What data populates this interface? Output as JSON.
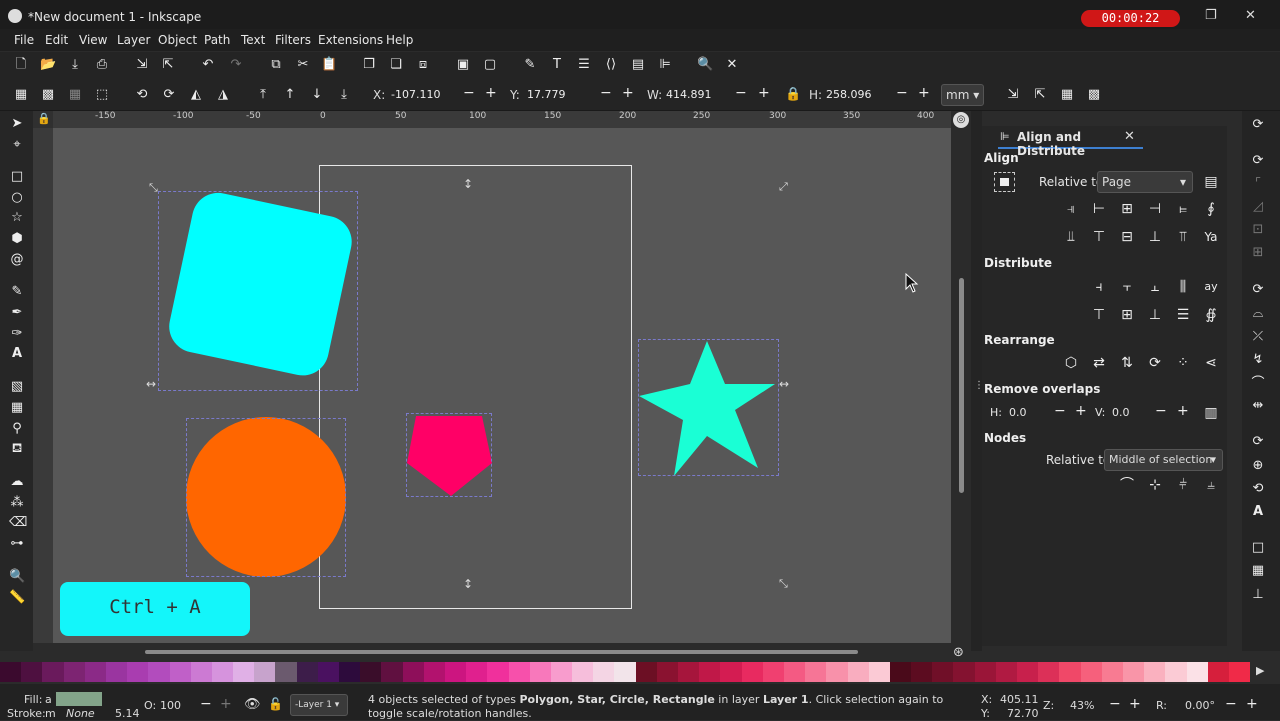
{
  "window": {
    "title": "*New document 1 - Inkscape",
    "timer": "00:00:22"
  },
  "menu": [
    "File",
    "Edit",
    "View",
    "Layer",
    "Object",
    "Path",
    "Text",
    "Filters",
    "Extensions",
    "Help"
  ],
  "toolcontrols": {
    "x_label": "X:",
    "x_value": "-107.110",
    "y_label": "Y:",
    "y_value": "17.779",
    "w_label": "W:",
    "w_value": "414.891",
    "h_label": "H:",
    "h_value": "258.096",
    "unit": "mm"
  },
  "ruler": {
    "top_ticks": [
      "-150",
      "-100",
      "-50",
      "0",
      "50",
      "100",
      "150",
      "200",
      "250",
      "300",
      "350",
      "400"
    ]
  },
  "canvas": {
    "colors": {
      "rect": "#00ffff",
      "circle": "#ff6600",
      "pentagon": "#ff0066",
      "star": "#1affd5",
      "canvas_bg": "#575757"
    },
    "overlay_text": "Ctrl + A"
  },
  "dock": {
    "tab_title": "Align and Distribute",
    "align": {
      "heading": "Align",
      "relative_label": "Relative to:",
      "relative_value": "Page"
    },
    "distribute": {
      "heading": "Distribute"
    },
    "rearrange": {
      "heading": "Rearrange"
    },
    "remove_overlaps": {
      "heading": "Remove overlaps",
      "h_label": "H:",
      "h_value": "0.0",
      "v_label": "V:",
      "v_value": "0.0"
    },
    "nodes": {
      "heading": "Nodes",
      "relative_label": "Relative to:",
      "relative_value": "Middle of selection"
    }
  },
  "palette": [
    "#3b0a2e",
    "#4e1040",
    "#6a1a5c",
    "#7d2472",
    "#8b2a87",
    "#9a35a0",
    "#a93db0",
    "#b24cbd",
    "#c060c8",
    "#cc7ad3",
    "#d693dd",
    "#e0b0e6",
    "#c7a3cc",
    "#6b5a6e",
    "#3d1d4a",
    "#4a1160",
    "#2d0b3c",
    "#3a0d2a",
    "#601040",
    "#8e0f5a",
    "#b2126e",
    "#cc1580",
    "#e0208e",
    "#f0309c",
    "#f750ab",
    "#f878bb",
    "#f89ccd",
    "#f6bedb",
    "#f4d5e4",
    "#f2e4ea",
    "#6c0f24",
    "#8a1230",
    "#a6153c",
    "#c01848",
    "#d41c52",
    "#e82a60",
    "#f04070",
    "#f45a83",
    "#f67596",
    "#f891aa",
    "#f9adbf",
    "#fbcad5",
    "#4a0a1a",
    "#5c0c20",
    "#700f28",
    "#841230",
    "#9a1538",
    "#b01a42",
    "#c8204c",
    "#dc3058",
    "#f04868",
    "#f6607c",
    "#f87b92",
    "#f995a8",
    "#fab1bf",
    "#fbcbd5",
    "#fbe1e7",
    "#d61f3c",
    "#f02a48"
  ],
  "status": {
    "fill_label": "Fill:",
    "fill_value": "a",
    "stroke_label": "Stroke:",
    "stroke_value": "m",
    "stroke_none": "None",
    "stroke_width": "5.14",
    "opacity_label": "O:",
    "opacity_value": "100",
    "layer": "-Layer 1",
    "msg_pre": "4 objects selected of types ",
    "msg_types": "Polygon, Star, Circle, Rectangle",
    "msg_mid": " in layer ",
    "msg_layer": "Layer 1",
    "msg_post": ". Click selection again to toggle scale/rotation handles.",
    "x_label": "X:",
    "x_value": "405.11",
    "y_label": "Y:",
    "y_value": "72.70",
    "zoom_label": "Z:",
    "zoom_value": "43%",
    "rot_label": "R:",
    "rot_value": "0.00°"
  }
}
